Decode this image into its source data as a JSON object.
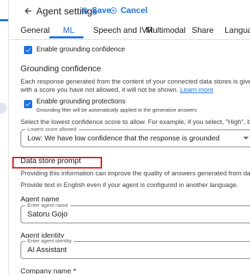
{
  "header": {
    "title": "Agent settings",
    "save_label": "Save",
    "cancel_label": "Cancel"
  },
  "tabs": [
    {
      "label": "General",
      "active": false
    },
    {
      "label": "ML",
      "active": true
    },
    {
      "label": "Speech and IVR",
      "active": false
    },
    {
      "label": "Multimodal",
      "active": false
    },
    {
      "label": "Share",
      "active": false
    },
    {
      "label": "Languages",
      "active": false
    }
  ],
  "grounding": {
    "enable_confidence_label": "Enable grounding confidence",
    "section_title": "Grounding confidence",
    "description_line1": "Each response generated from the content of your connected data stores is given a score of how",
    "description_line2": "with a score you have not allowed, it will not be shown.",
    "learn_more": "Learn more",
    "protections_label": "Enable grounding protections",
    "protections_hint": "Grounding filter will be automatically applied to the generative answers",
    "select_instruction": "Select the lowest confidence score to allow. For example, if you select, \"High\", both \"High\" and \"Ve",
    "lowest_score_label": "Lowest score allowed",
    "lowest_score_value": "Low: We have low confidence that the response is grounded"
  },
  "data_store_prompt": {
    "section_title": "Data store prompt",
    "info_line1": "Providing this information can improve the quality of answers generated from data store content",
    "info_line2": "Provide text in English even if your agent is configured in another language.",
    "agent_name_label": "Agent name",
    "agent_name_placeholder": "Enter agent name",
    "agent_name_value": "Satoru Gojo",
    "agent_identity_label": "Agent identity",
    "agent_identity_placeholder": "Enter agent identity",
    "agent_identity_value": "AI Assistant",
    "company_name_label": "Company name *"
  },
  "colors": {
    "accent": "#1a73e8",
    "highlight": "#e0191f"
  }
}
